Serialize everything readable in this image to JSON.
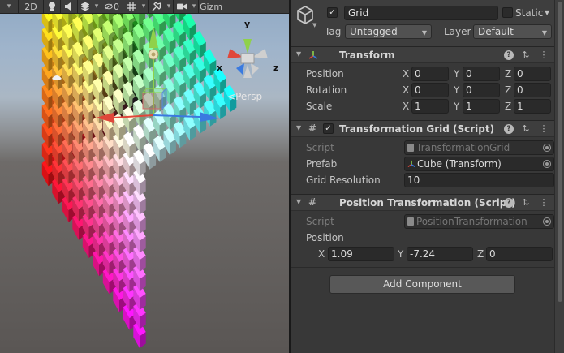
{
  "scene_toolbar": {
    "mode_2d": "2D",
    "fx_count": "0",
    "gizmos_label": "Gizm",
    "icons": [
      "dropdown-arrow-icon",
      "lightbulb-icon",
      "audio-icon",
      "effects-icon",
      "hidden-objects-icon",
      "grid-icon",
      "tools-icon",
      "camera-icon"
    ]
  },
  "scene": {
    "persp_label": "Persp",
    "gizmo_axes": {
      "y": "y",
      "x": "x",
      "z": "z"
    },
    "axis_colors": {
      "x": "#e0473a",
      "y": "#8fd14a",
      "z": "#3a7ae0"
    }
  },
  "header": {
    "active": true,
    "name": "Grid",
    "static_label": "Static",
    "static_checked": false,
    "tag_label": "Tag",
    "tag_value": "Untagged",
    "layer_label": "Layer",
    "layer_value": "Default"
  },
  "transform": {
    "title": "Transform",
    "rows": [
      {
        "label": "Position",
        "x": "0",
        "y": "0",
        "z": "0"
      },
      {
        "label": "Rotation",
        "x": "0",
        "y": "0",
        "z": "0"
      },
      {
        "label": "Scale",
        "x": "1",
        "y": "1",
        "z": "1"
      }
    ]
  },
  "grid_script": {
    "title": "Transformation Grid (Script)",
    "enabled": true,
    "script_label": "Script",
    "script_value": "TransformationGrid",
    "prefab_label": "Prefab",
    "prefab_value": "Cube (Transform)",
    "resolution_label": "Grid Resolution",
    "resolution_value": "10"
  },
  "position_script": {
    "title": "Position Transformation (Script)",
    "script_label": "Script",
    "script_value": "PositionTransformation",
    "position_label": "Position",
    "x": "1.09",
    "y": "-7.24",
    "z": "0"
  },
  "axis_labels": {
    "x": "X",
    "y": "Y",
    "z": "Z"
  },
  "add_component": "Add Component"
}
